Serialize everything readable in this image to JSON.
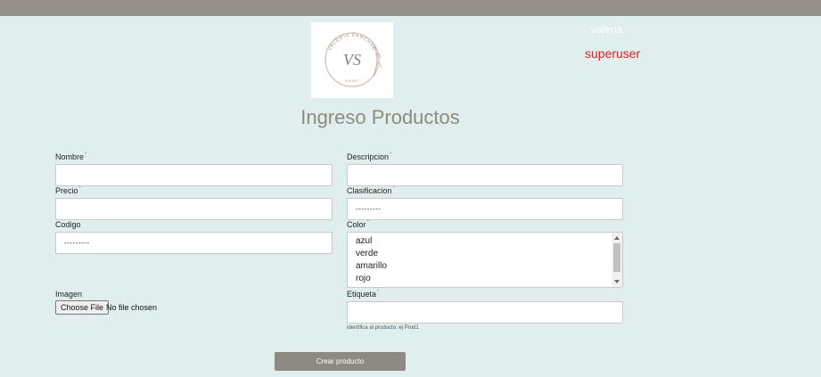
{
  "header": {
    "logo_text_top": "VALERIA SANCHEZ",
    "logo_monogram": "VS",
    "logo_text_bottom": "SHOP",
    "user_name": "valeria",
    "user_role": "superuser"
  },
  "page_title": "Ingreso Productos",
  "form": {
    "nombre_label": "Nombre",
    "descripcion_label": "Descripcion",
    "precio_label": "Precio",
    "clasificacion_label": "Clasificacion",
    "clasificacion_value": "---------",
    "codigo_label": "Codigo",
    "codigo_value": "---------",
    "color_label": "Color",
    "color_options": [
      "azul",
      "verde",
      "amarillo",
      "rojo"
    ],
    "imagen_label": "Imagen",
    "file_button": "Choose File",
    "file_status": "No file chosen",
    "etiqueta_label": "Etiqueta",
    "etiqueta_help": "identifica al producto: ej Prod1",
    "required_mark": "*",
    "submit_label": "Crear producto"
  },
  "colors": {
    "topbar": "#948f88",
    "background": "#e0efed",
    "title": "#8e8a7e",
    "role": "#e02020",
    "button": "#8d8a83"
  }
}
